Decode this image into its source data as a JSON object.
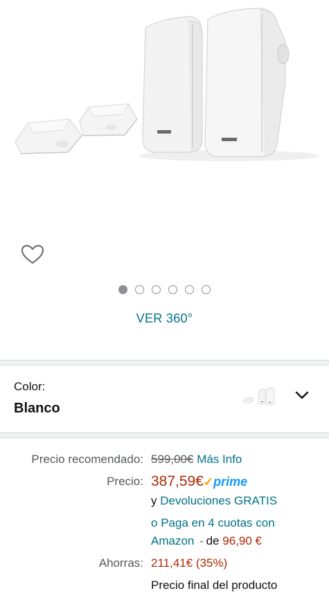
{
  "gallery": {
    "dots_total": 6,
    "active_dot": 0,
    "view360_label": "VER 360°"
  },
  "color": {
    "label": "Color:",
    "value": "Blanco"
  },
  "pricing": {
    "list_label": "Precio recomendado:",
    "list_price": "599,00€",
    "more_info": "Más Info",
    "price_label": "Precio:",
    "price": "387,59€",
    "prime_check": "✓",
    "prime_word": "prime",
    "returns_prefix": "y",
    "returns_link": "Devoluciones GRATIS",
    "install_prefix": "o",
    "install_link_1": "Paga en 4 cuotas con",
    "install_link_2": "Amazon",
    "install_de": "de",
    "install_amount": "96,90 €",
    "savings_label": "Ahorras:",
    "savings_value": "211,41€ (35%)",
    "final_note": "Precio final del producto"
  },
  "colors": {
    "link": "#007185",
    "price_red": "#b12704",
    "prime_blue": "#1399ff",
    "prime_orange": "#ff9900"
  },
  "icons": [
    "heart-icon",
    "chevron-down-icon",
    "small-chevron-icon"
  ]
}
